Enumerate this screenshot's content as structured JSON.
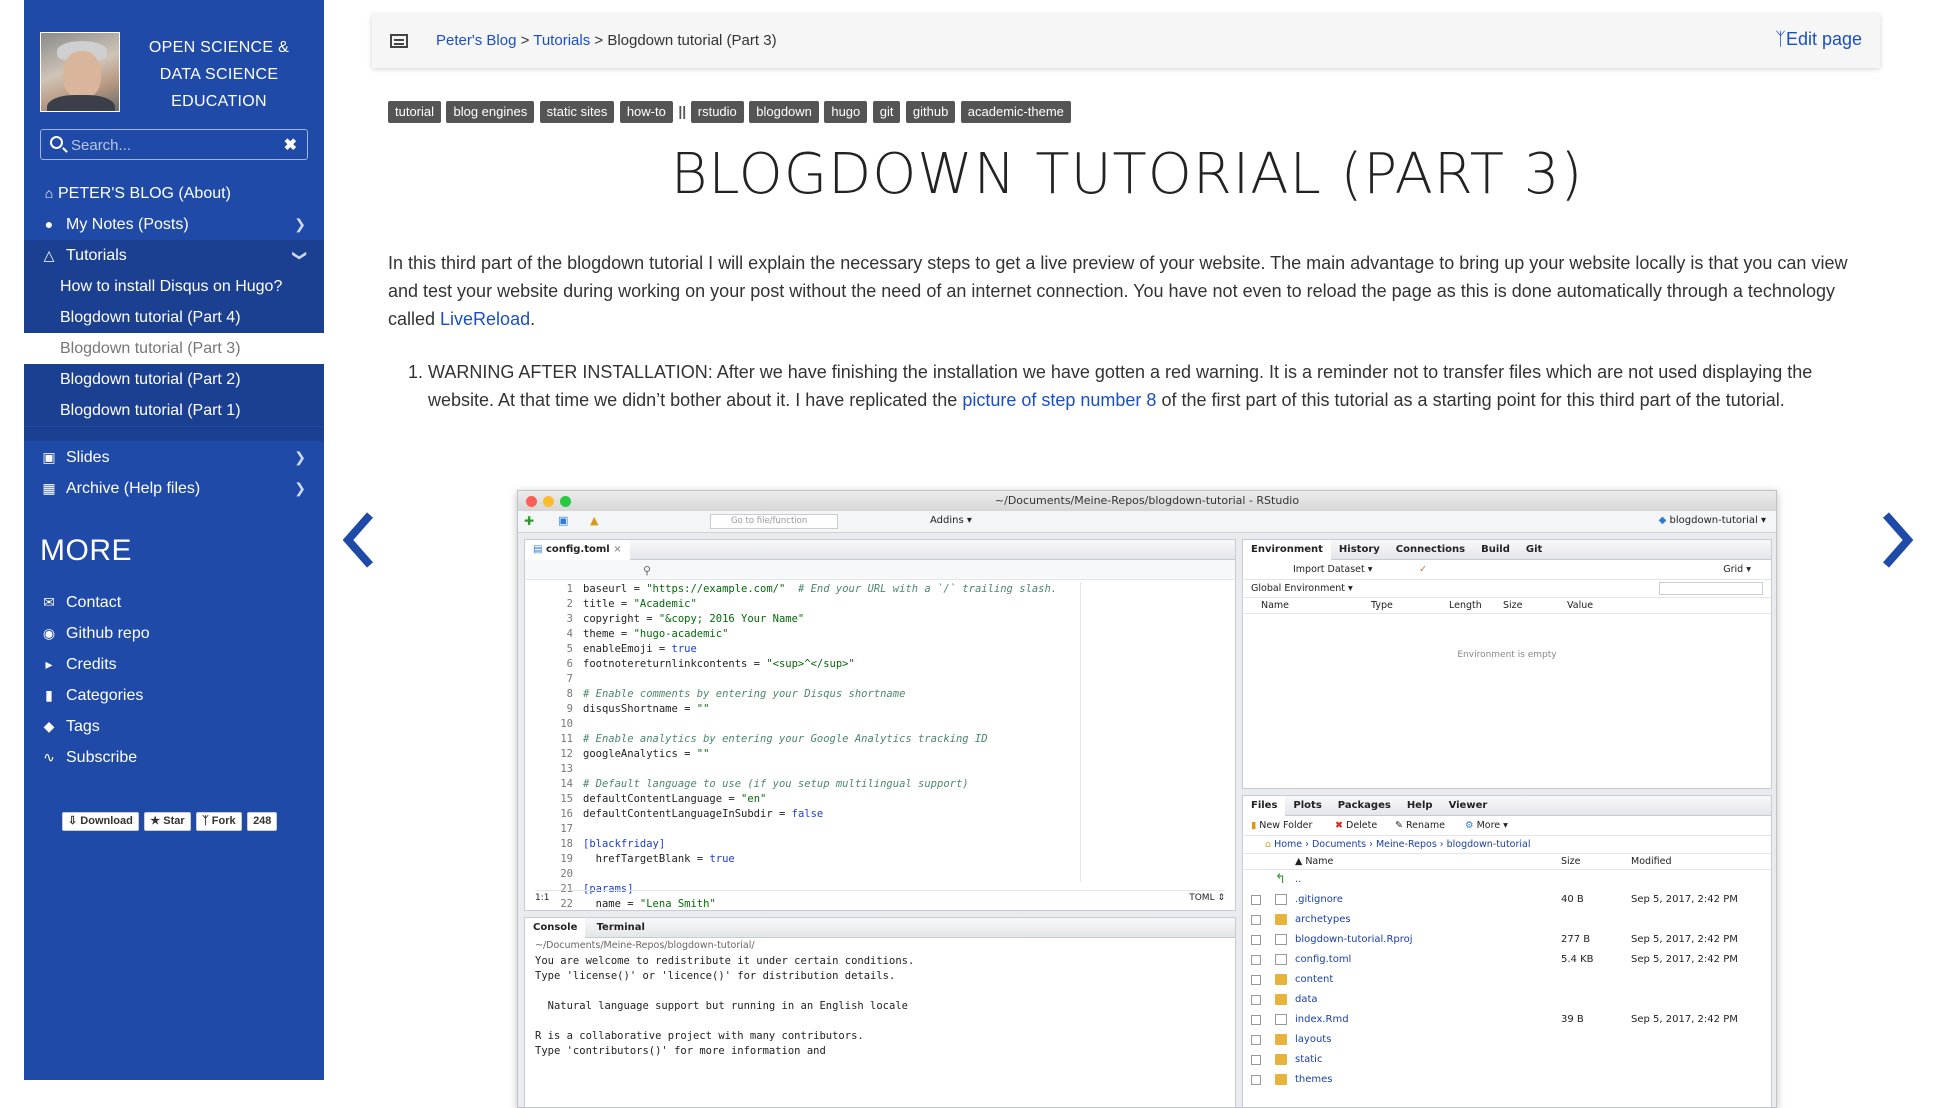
{
  "sidebar": {
    "site_title_line1": "OPEN SCIENCE &",
    "site_title_line2": "DATA SCIENCE",
    "site_title_line3": "EDUCATION",
    "search_placeholder": "Search...",
    "search_clear": "✖",
    "nav": [
      {
        "label": "PETER'S BLOG (About)",
        "icon": "home-icon"
      },
      {
        "label": "My Notes (Posts)",
        "icon": "user-icon"
      },
      {
        "label": "Tutorials",
        "icon": "graduation-cap-icon"
      }
    ],
    "tutorials": [
      "How to install Disqus on Hugo?",
      "Blogdown tutorial (Part 4)",
      "Blogdown tutorial (Part 3)",
      "Blogdown tutorial (Part 2)",
      "Blogdown tutorial (Part 1)"
    ],
    "nav2": [
      {
        "label": "Slides",
        "icon": "desktop-icon"
      },
      {
        "label": "Archive (Help files)",
        "icon": "archive-icon"
      }
    ],
    "more_heading": "MORE",
    "more": [
      {
        "label": "Contact",
        "icon": "envelope-icon"
      },
      {
        "label": "Github repo",
        "icon": "github-icon"
      },
      {
        "label": "Credits",
        "icon": "bullhorn-icon"
      },
      {
        "label": "Categories",
        "icon": "bookmark-icon"
      },
      {
        "label": "Tags",
        "icon": "tags-icon"
      },
      {
        "label": "Subscribe",
        "icon": "rss-icon"
      }
    ],
    "github_buttons": {
      "download": "Download",
      "star": "Star",
      "fork": "Fork",
      "fork_count": "248"
    }
  },
  "topbar": {
    "breadcrumb": {
      "home": "Peter's Blog",
      "sep1": " > ",
      "section": "Tutorials",
      "sep2": " > ",
      "current": "Blogdown tutorial (Part 3)"
    },
    "edit_label": "Edit page"
  },
  "tags_before": [
    "tutorial",
    "blog engines",
    "static sites",
    "how-to"
  ],
  "tag_separator": "||",
  "tags_after": [
    "rstudio",
    "blogdown",
    "hugo",
    "git",
    "github",
    "academic-theme"
  ],
  "page_title": "BLOGDOWN TUTORIAL (PART 3)",
  "article": {
    "intro": "In this third part of the blogdown tutorial I will explain the necessary steps to get a live preview of your website. The main advantage to bring up your website locally is that you can view and test your website during working on your post without the need of an internet connection. You have not even to reload the page as this is done automatically through a technology called ",
    "intro_link": "LiveReload",
    "intro_end": ".",
    "item1_a": "WARNING AFTER INSTALLATION: After we have finishing the installation we have gotten a red warning. It is a reminder not to transfer files which are not used displaying the website. At that time we didn’t bother about it. I have replicated the ",
    "item1_link": "picture of step number 8",
    "item1_b": " of the first part of this tutorial as a starting point for this third part of the tutorial."
  },
  "rstudio": {
    "window_title": "~/Documents/Meine-Repos/blogdown-tutorial - RStudio",
    "goto_placeholder": "Go to file/function",
    "addins": "Addins",
    "project": "blogdown-tutorial",
    "editor_tab": "config.toml",
    "cursor_pos": "1:1",
    "file_type": "TOML",
    "code_lines": [
      {
        "n": "1",
        "t": "baseurl = \"https://example.com/\"  # End your URL with a `/` trailing slash."
      },
      {
        "n": "2",
        "t": "title = \"Academic\""
      },
      {
        "n": "3",
        "t": "copyright = \"&copy; 2016 Your Name\""
      },
      {
        "n": "4",
        "t": "theme = \"hugo-academic\""
      },
      {
        "n": "5",
        "t": "enableEmoji = true"
      },
      {
        "n": "6",
        "t": "footnotereturnlinkcontents = \"<sup>^</sup>\""
      },
      {
        "n": "7",
        "t": ""
      },
      {
        "n": "8",
        "t": "# Enable comments by entering your Disqus shortname"
      },
      {
        "n": "9",
        "t": "disqusShortname = \"\""
      },
      {
        "n": "10",
        "t": ""
      },
      {
        "n": "11",
        "t": "# Enable analytics by entering your Google Analytics tracking ID"
      },
      {
        "n": "12",
        "t": "googleAnalytics = \"\""
      },
      {
        "n": "13",
        "t": ""
      },
      {
        "n": "14",
        "t": "# Default language to use (if you setup multilingual support)"
      },
      {
        "n": "15",
        "t": "defaultContentLanguage = \"en\""
      },
      {
        "n": "16",
        "t": "defaultContentLanguageInSubdir = false"
      },
      {
        "n": "17",
        "t": ""
      },
      {
        "n": "18",
        "t": "[blackfriday]"
      },
      {
        "n": "19",
        "t": "  hrefTargetBlank = true"
      },
      {
        "n": "20",
        "t": ""
      },
      {
        "n": "21",
        "t": "[params]"
      },
      {
        "n": "22",
        "t": "  name = \"Lena Smith\""
      }
    ],
    "console_tabs": [
      "Console",
      "Terminal"
    ],
    "console_path": "~/Documents/Meine-Repos/blogdown-tutorial/",
    "console_lines": [
      "You are welcome to redistribute it under certain conditions.",
      "Type 'license()' or 'licence()' for distribution details.",
      "",
      "  Natural language support but running in an English locale",
      "",
      "R is a collaborative project with many contributors.",
      "Type 'contributors()' for more information and"
    ],
    "env_tabs": [
      "Environment",
      "History",
      "Connections",
      "Build",
      "Git"
    ],
    "import_dataset": "Import Dataset",
    "grid_label": "Grid",
    "global_env": "Global Environment",
    "env_columns": [
      "Name",
      "Type",
      "Length",
      "Size",
      "Value"
    ],
    "env_empty": "Environment is empty",
    "files_tabs": [
      "Files",
      "Plots",
      "Packages",
      "Help",
      "Viewer"
    ],
    "files_toolbar": [
      "New Folder",
      "Delete",
      "Rename",
      "More"
    ],
    "files_path": [
      "Home",
      "Documents",
      "Meine-Repos",
      "blogdown-tutorial"
    ],
    "files_columns": [
      "Name",
      "Size",
      "Modified"
    ],
    "files": [
      {
        "name": "..",
        "size": "",
        "modified": "",
        "kind": "up"
      },
      {
        "name": ".gitignore",
        "size": "40 B",
        "modified": "Sep 5, 2017, 2:42 PM",
        "kind": "file"
      },
      {
        "name": "archetypes",
        "size": "",
        "modified": "",
        "kind": "folder"
      },
      {
        "name": "blogdown-tutorial.Rproj",
        "size": "277 B",
        "modified": "Sep 5, 2017, 2:42 PM",
        "kind": "file"
      },
      {
        "name": "config.toml",
        "size": "5.4 KB",
        "modified": "Sep 5, 2017, 2:42 PM",
        "kind": "file"
      },
      {
        "name": "content",
        "size": "",
        "modified": "",
        "kind": "folder"
      },
      {
        "name": "data",
        "size": "",
        "modified": "",
        "kind": "folder"
      },
      {
        "name": "index.Rmd",
        "size": "39 B",
        "modified": "Sep 5, 2017, 2:42 PM",
        "kind": "file"
      },
      {
        "name": "layouts",
        "size": "",
        "modified": "",
        "kind": "folder"
      },
      {
        "name": "static",
        "size": "",
        "modified": "",
        "kind": "folder"
      },
      {
        "name": "themes",
        "size": "",
        "modified": "",
        "kind": "folder"
      }
    ]
  },
  "colors": {
    "sidebar": "#1f4aa8",
    "link": "#1a4fc4",
    "tag": "#555555",
    "arrow": "#1f4aa8"
  }
}
